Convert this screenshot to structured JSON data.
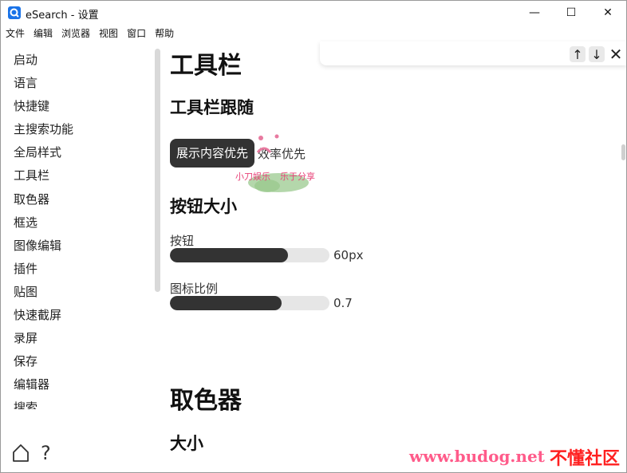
{
  "window": {
    "title": "eSearch - 设置"
  },
  "window_controls": {
    "minimize": "—",
    "maximize": "☐",
    "close": "✕"
  },
  "menu": [
    "文件",
    "编辑",
    "浏览器",
    "视图",
    "窗口",
    "帮助"
  ],
  "sidebar": {
    "items": [
      "启动",
      "语言",
      "快捷键",
      "主搜索功能",
      "全局样式",
      "工具栏",
      "取色器",
      "框选",
      "图像编辑",
      "插件",
      "贴图",
      "快速截屏",
      "录屏",
      "保存",
      "编辑器",
      "搜索"
    ]
  },
  "bottom": {
    "help": "?"
  },
  "findbar": {
    "up": "↑",
    "down": "↓",
    "close": "✕"
  },
  "main": {
    "toolbar_heading": "工具栏",
    "follow_heading": "工具栏跟随",
    "follow_options": {
      "selected": "展示内容优先",
      "other": "效率优先"
    },
    "button_size_heading": "按钮大小",
    "button_label": "按钮",
    "button_value": "60px",
    "button_fill": 0.74,
    "icon_ratio_label": "图标比例",
    "icon_ratio_value": "0.7",
    "icon_ratio_fill": 0.7,
    "picker_heading": "取色器",
    "size_heading": "大小"
  },
  "watermark": {
    "seal_text": "小刀娱乐 乐于分享",
    "url": "www.budog.net",
    "brand": "不懂社区"
  },
  "colors": {
    "accent": "#333333",
    "track": "#e6e6e6",
    "watermark_pink": "#ff5b8a",
    "watermark_red": "#ff2020"
  }
}
